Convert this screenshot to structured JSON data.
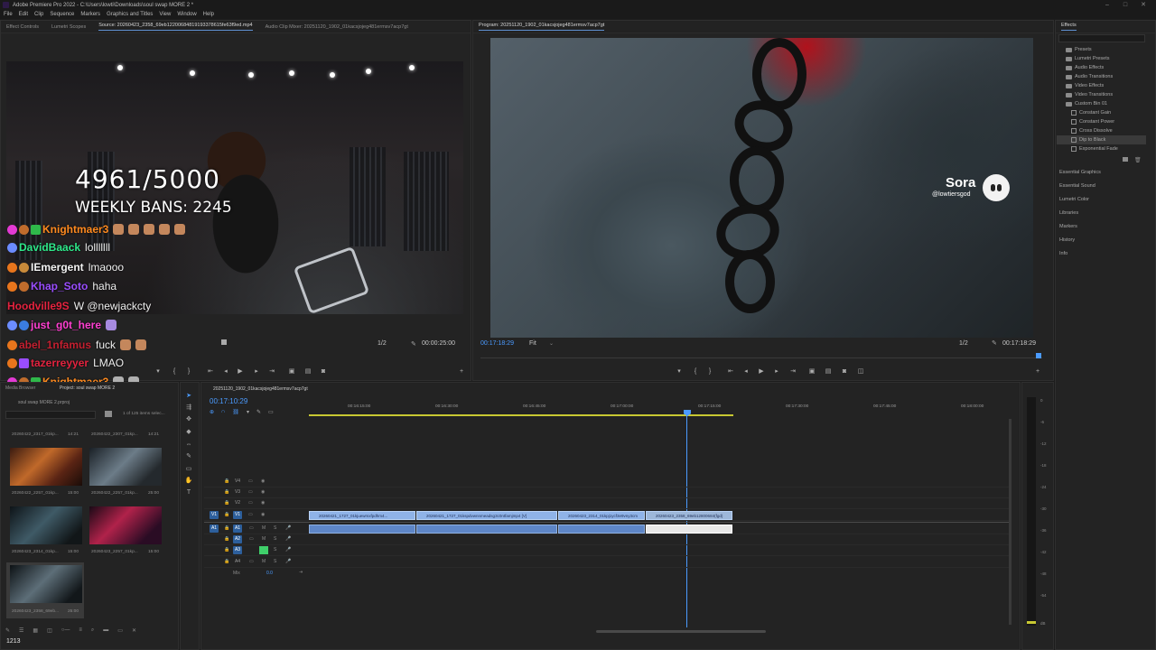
{
  "app": {
    "title": "Adobe Premiere Pro 2022 - C:\\Users\\lowti\\Downloads\\soul swap MORE 2 *",
    "window_controls": [
      "–",
      "□",
      "✕"
    ]
  },
  "menu": [
    "File",
    "Edit",
    "Clip",
    "Sequence",
    "Markers",
    "Graphics and Titles",
    "View",
    "Window",
    "Help"
  ],
  "source_panel": {
    "tabs": [
      "Effect Controls",
      "Lumetri Scopes",
      "Source: 20260423_2358_69eb12200684819193378615fe63f9ed.mp4",
      "Audio Clip Mixer: 20251120_1902_01kacsjojeg481ermsv7acp7gt"
    ],
    "active_tab": 2,
    "overlay": {
      "counter": "4961/5000",
      "bans": "WEEKLY BANS: 2245"
    },
    "chat": [
      {
        "user": "Knightmaer3",
        "msg": "",
        "color": "#ff8a1f"
      },
      {
        "user": "DavidBaack",
        "msg": "lolllllll",
        "color": "#2ee88a"
      },
      {
        "user": "IEmergent",
        "msg": "lmaooo",
        "color": "#f4f4f4"
      },
      {
        "user": "Khap_Soto",
        "msg": "haha",
        "color": "#9a4dff"
      },
      {
        "user": "Hoodville9S",
        "msg": "W @newjackcty",
        "color": "#e4233f"
      },
      {
        "user": "just_g0t_here",
        "msg": "",
        "color": "#ff3fd1"
      },
      {
        "user": "abel_1nfamus",
        "msg": "fuck",
        "color": "#c42030"
      },
      {
        "user": "tazerreyyer",
        "msg": "LMAO",
        "color": "#e4233f"
      },
      {
        "user": "Knightmaer3",
        "msg": "",
        "color": "#ff8a1f"
      }
    ],
    "zoom": "1/2",
    "timecode": "00:00:25:00"
  },
  "program_panel": {
    "title": "Program: 20251120_1902_01kacsjojeg481ermsv7acp7gt",
    "watermark_name": "Sora",
    "watermark_handle": "@lowtiersgod",
    "playhead_tc": "00:17:18:29",
    "fit": "Fit",
    "zoom": "1/2",
    "duration_tc": "00:17:18:29"
  },
  "effects_panel": {
    "title": "Effects",
    "tree": [
      {
        "label": "Presets",
        "type": "folder",
        "indent": 0
      },
      {
        "label": "Lumetri Presets",
        "type": "folder",
        "indent": 0
      },
      {
        "label": "Audio Effects",
        "type": "folder",
        "indent": 0
      },
      {
        "label": "Audio Transitions",
        "type": "folder",
        "indent": 0
      },
      {
        "label": "Video Effects",
        "type": "folder",
        "indent": 0
      },
      {
        "label": "Video Transitions",
        "type": "folder",
        "indent": 0
      },
      {
        "label": "Custom Bin 01",
        "type": "folder",
        "indent": 0
      },
      {
        "label": "Constant Gain",
        "type": "fx",
        "indent": 1
      },
      {
        "label": "Constant Power",
        "type": "fx",
        "indent": 1
      },
      {
        "label": "Cross Dissolve",
        "type": "fx",
        "indent": 1
      },
      {
        "label": "Dip to Black",
        "type": "fx",
        "indent": 1,
        "selected": true
      },
      {
        "label": "Exponential Fade",
        "type": "fx",
        "indent": 1
      }
    ],
    "sections": [
      "Essential Graphics",
      "Essential Sound",
      "Lumetri Color",
      "Libraries",
      "Markers",
      "History",
      "Info"
    ]
  },
  "project_panel": {
    "tabs": [
      "Media Browser",
      "Project: soul swap MORE 2"
    ],
    "project_file": "soul swap MORE 2.prproj",
    "selection_count": "1 of 125 items selec...",
    "items": [
      {
        "name": "20260422_2317_01kp...",
        "dur": "14:21"
      },
      {
        "name": "20260422_2307_01kp...",
        "dur": "14:21"
      },
      {
        "name": "20260422_2257_01kp...",
        "dur": "15:00"
      },
      {
        "name": "20260422_2257_01kp...",
        "dur": "25:00"
      },
      {
        "name": "20260423_2314_01kp...",
        "dur": "15:00"
      },
      {
        "name": "20260423_2257_01kp...",
        "dur": "15:00"
      },
      {
        "name": "20260423_2358_69eb...",
        "dur": "25:00"
      }
    ],
    "footer_count": "1213"
  },
  "timeline": {
    "tab": "20251120_1902_01kacsjojeg481ermsv7acp7gt",
    "timecode": "00:17:10:29",
    "ruler": [
      "00:16:15:00",
      "00:16:30:00",
      "00:16:45:00",
      "00:17:00:00",
      "00:17:15:00",
      "00:17:30:00",
      "00:17:45:00",
      "00:18:00:00"
    ],
    "video_tracks": [
      "V4",
      "V3",
      "V2",
      "V1"
    ],
    "audio_tracks": [
      "A1",
      "A2",
      "A3",
      "A4"
    ],
    "mix_label": "Mix",
    "mix_value": "0.0",
    "clips": [
      {
        "name": "20260421_1727_01kjuewmxfpdhm4..."
      },
      {
        "name": "20260421_1727_01kspdvwnnmeadsg3c0ntfamjmp4 [V]"
      },
      {
        "name": "20260423_2314_01kpj1ycf3e9vny3cm"
      },
      {
        "name": "20260423_2358_69eb12800684(fgd)"
      }
    ]
  },
  "audio_meter": {
    "ticks": [
      "0",
      "-6",
      "-12",
      "-18",
      "-24",
      "-30",
      "-36",
      "-42",
      "-48",
      "-54",
      "dB"
    ]
  }
}
